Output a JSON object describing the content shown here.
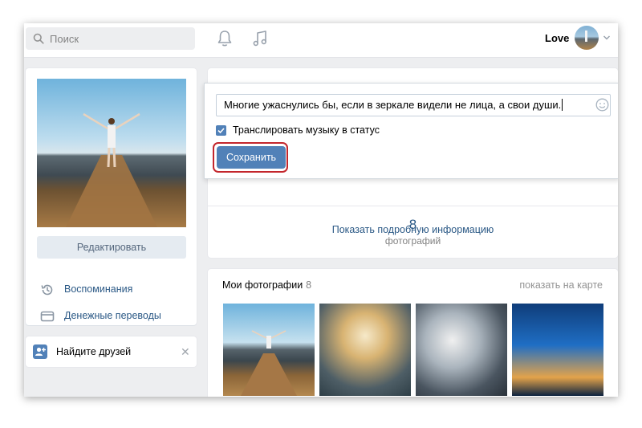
{
  "header": {
    "search_placeholder": "Поиск",
    "user_name": "Love",
    "icons": [
      "search-icon",
      "bell-icon",
      "music-note-icon",
      "chevron-down-icon"
    ]
  },
  "left": {
    "edit_label": "Редактировать",
    "menu": [
      {
        "label": "Воспоминания",
        "icon": "history-icon"
      },
      {
        "label": "Денежные переводы",
        "icon": "card-transfer-icon"
      }
    ],
    "find_friends": {
      "label": "Найдите друзей",
      "close": "✕"
    }
  },
  "status_popup": {
    "status_text": "Многие ужаснулись бы, если в зеркале видели не лица, а свои души.",
    "broadcast_label": "Транслировать музыку в статус",
    "broadcast_checked": true,
    "save_label": "Сохранить"
  },
  "profile": {
    "show_more_label": "Показать подробную информацию",
    "photos_count": "8",
    "photos_count_label": "фотографий"
  },
  "photos": {
    "title": "Мои фотографии",
    "count": "8",
    "map_link": "показать на карте"
  },
  "colors": {
    "accent": "#5181b8",
    "link": "#2a5885",
    "highlight": "#c3262c",
    "background": "#edeef0"
  }
}
